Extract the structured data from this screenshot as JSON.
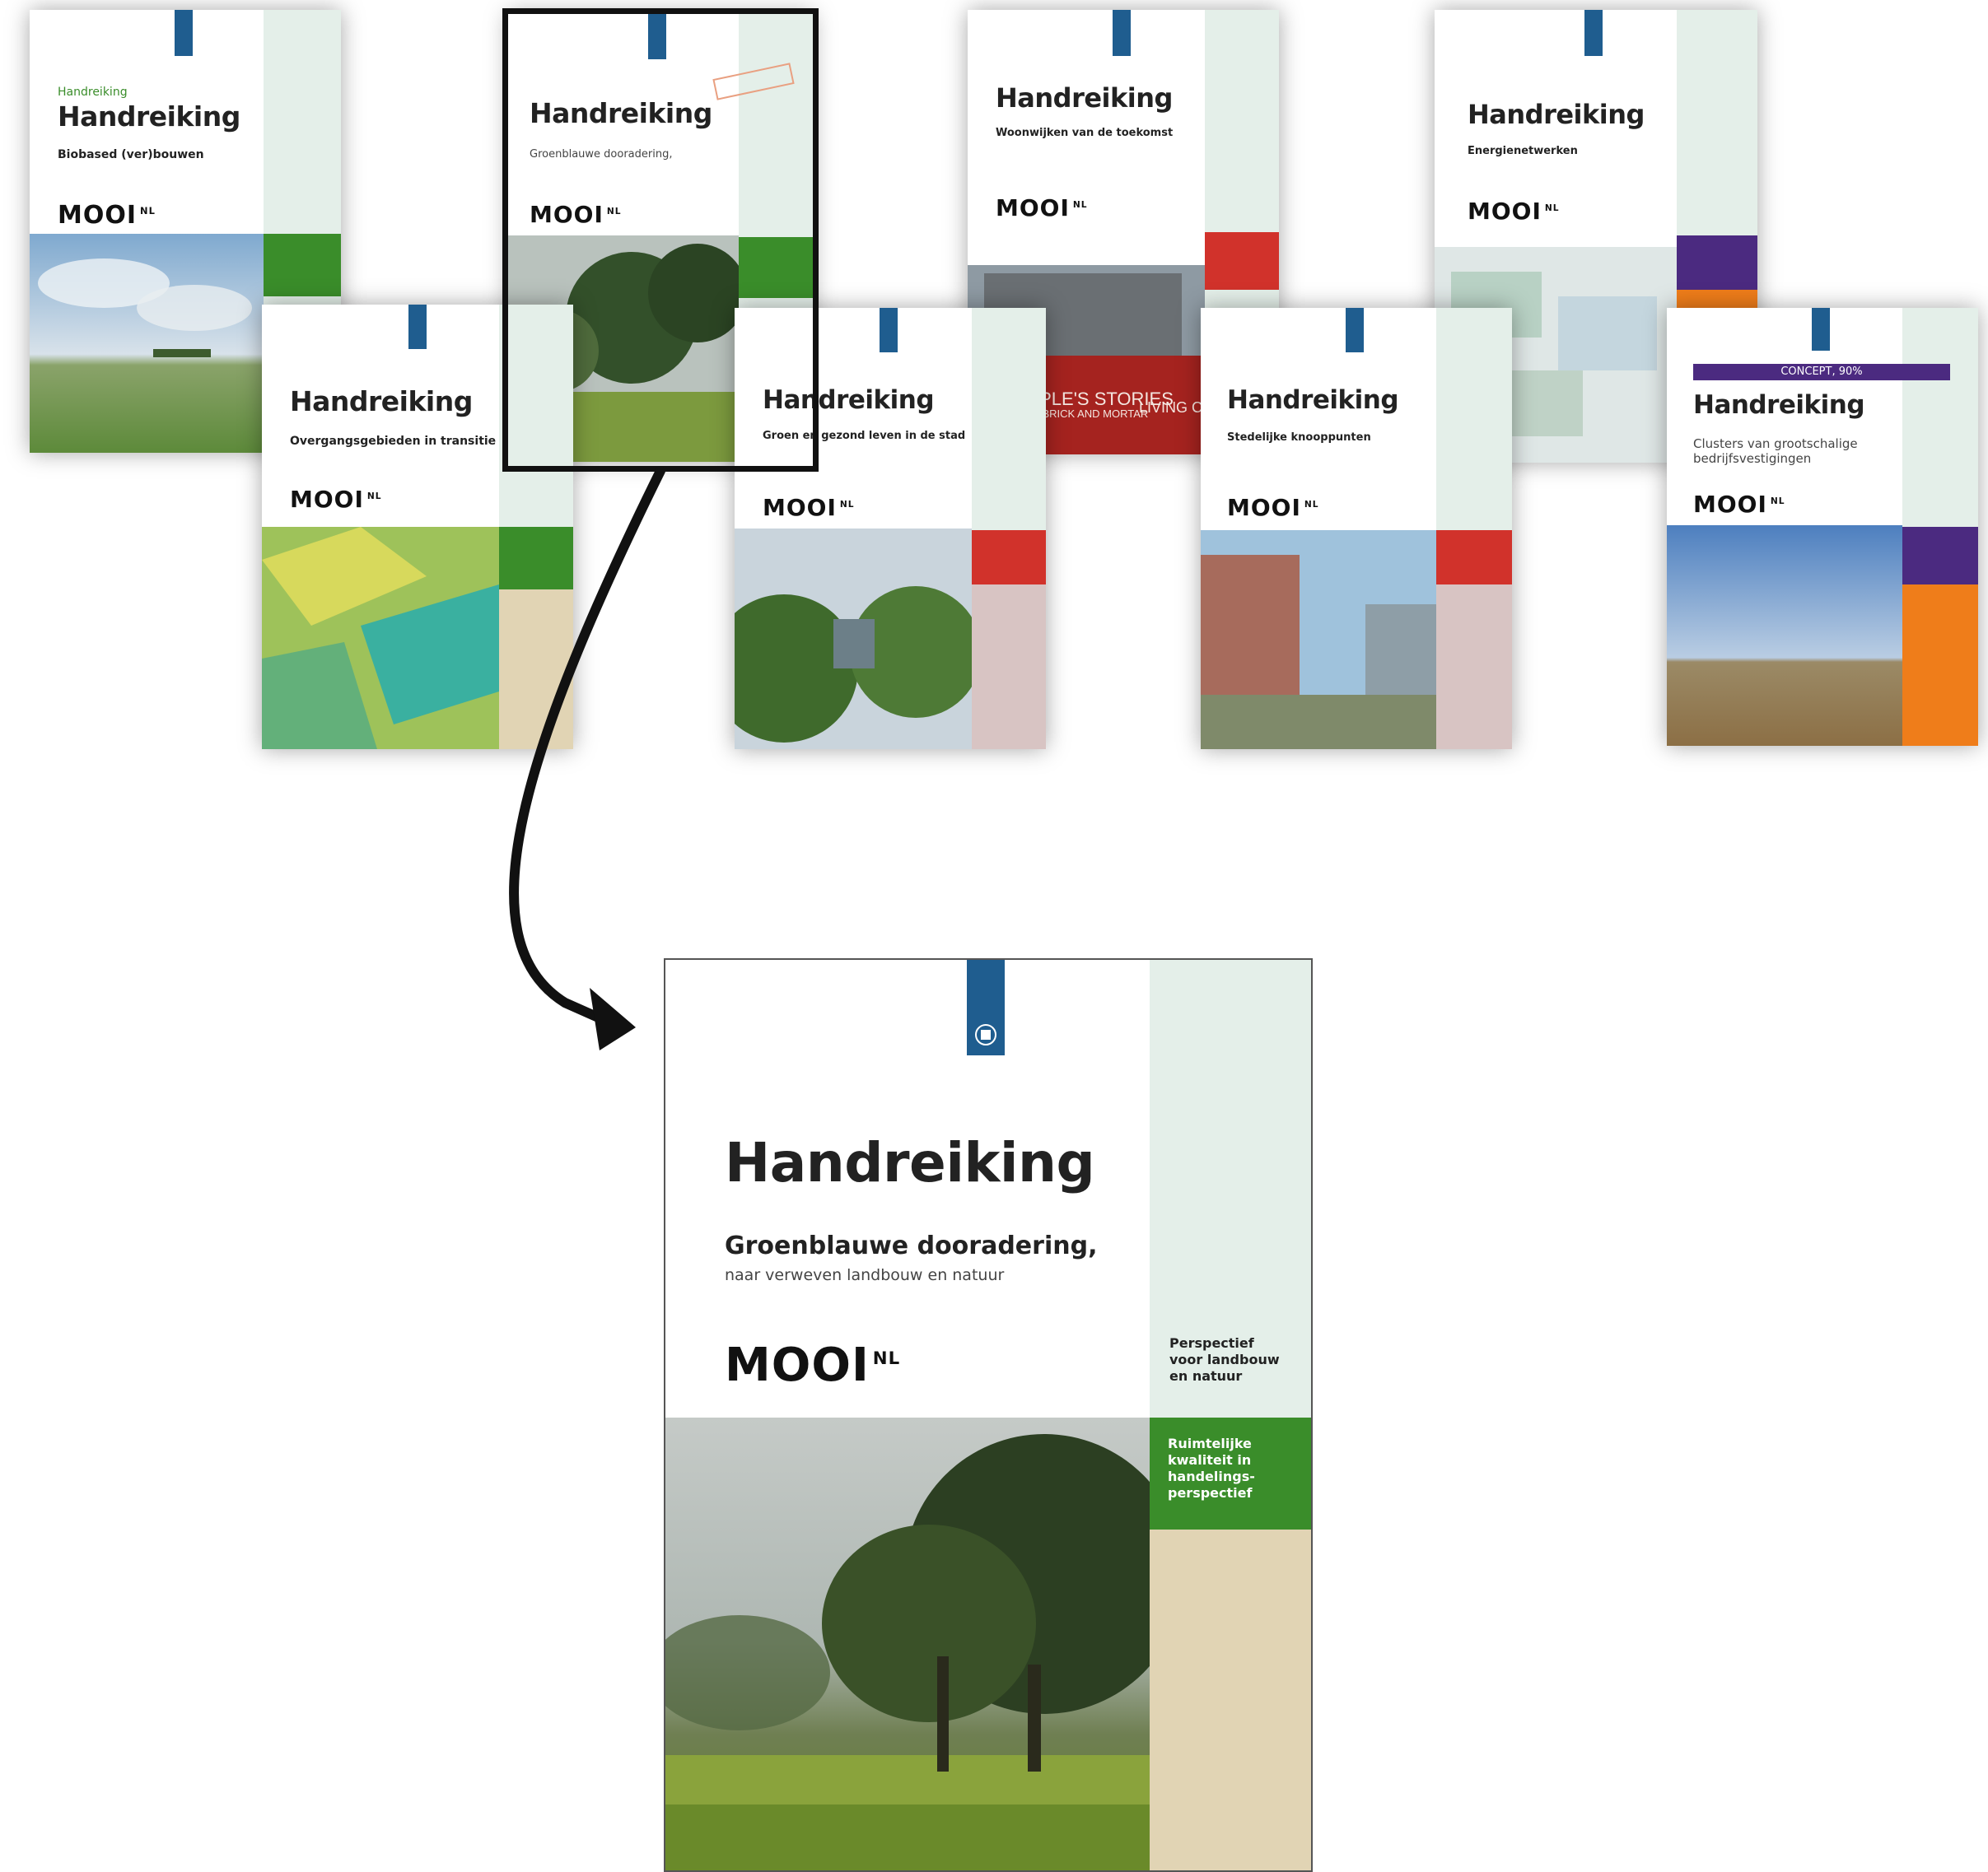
{
  "covers": {
    "biobased": {
      "kicker": "Handreiking",
      "title": "Handreiking",
      "subtitle": "Biobased (ver)bouwen",
      "logo": "MOOI",
      "logo_sup": "NL",
      "colors": {
        "theme": "#3a8d2a",
        "band": "#e4efe9"
      }
    },
    "overgang": {
      "title": "Handreiking",
      "subtitle": "Overgangsgebieden in transitie",
      "logo": "MOOI",
      "logo_sup": "NL",
      "colors": {
        "theme": "#3a8d2a",
        "lower": "#e1d4b4"
      }
    },
    "groenblauw_small": {
      "title": "Handreiking",
      "subtitle": "Groenblauwe dooradering,",
      "logo": "MOOI",
      "logo_sup": "NL",
      "colors": {
        "theme": "#3a8d2a"
      }
    },
    "wonen": {
      "title": "Handreiking",
      "subtitle": "Woonwijken van de toekomst",
      "logo": "MOOI",
      "logo_sup": "NL",
      "photo_text_line1": "OF PEOPLE'S STORIES",
      "photo_text_line2": "CRADLED BY BRICK AND MORTAR",
      "photo_text_line3": "LIVING CA",
      "colors": {
        "theme": "#d1322b"
      }
    },
    "gezond": {
      "title": "Handreiking",
      "subtitle": "Groen en gezond leven in de stad",
      "logo": "MOOI",
      "logo_sup": "NL",
      "colors": {
        "theme": "#d1322b",
        "lower": "#d8c4c3"
      }
    },
    "knooppunten": {
      "title": "Handreiking",
      "subtitle": "Stedelijke knooppunten",
      "logo": "MOOI",
      "logo_sup": "NL",
      "colors": {
        "theme": "#d1322b",
        "lower": "#d8c4c3"
      }
    },
    "energie": {
      "title": "Handreiking",
      "subtitle": "Energienetwerken",
      "logo": "MOOI",
      "logo_sup": "NL",
      "colors": {
        "theme": "#4b2a80"
      }
    },
    "clusters": {
      "concept": "CONCEPT, 90%",
      "title": "Handreiking",
      "subtitle": "Clusters van grootschalige bedrijfsvestigingen",
      "logo": "MOOI",
      "logo_sup": "NL",
      "colors": {
        "theme": "#4b2a80",
        "lower": "#ef7d1a"
      }
    }
  },
  "featured": {
    "title": "Handreiking",
    "subtitle": "Groenblauwe dooradering,",
    "subtitle_small": "naar verweven landbouw en natuur",
    "logo": "MOOI",
    "logo_sup": "NL",
    "perspective": "Perspectief voor landbouw en natuur",
    "theme": "Ruimtelijke kwaliteit in handelings-perspectief",
    "colors": {
      "band": "#e4efe9",
      "theme": "#3a8d2a",
      "lower": "#e1d4b4",
      "flag": "#1f5d8f"
    }
  },
  "annotation": {
    "box_color": "#111111",
    "arrow_color": "#111111"
  }
}
